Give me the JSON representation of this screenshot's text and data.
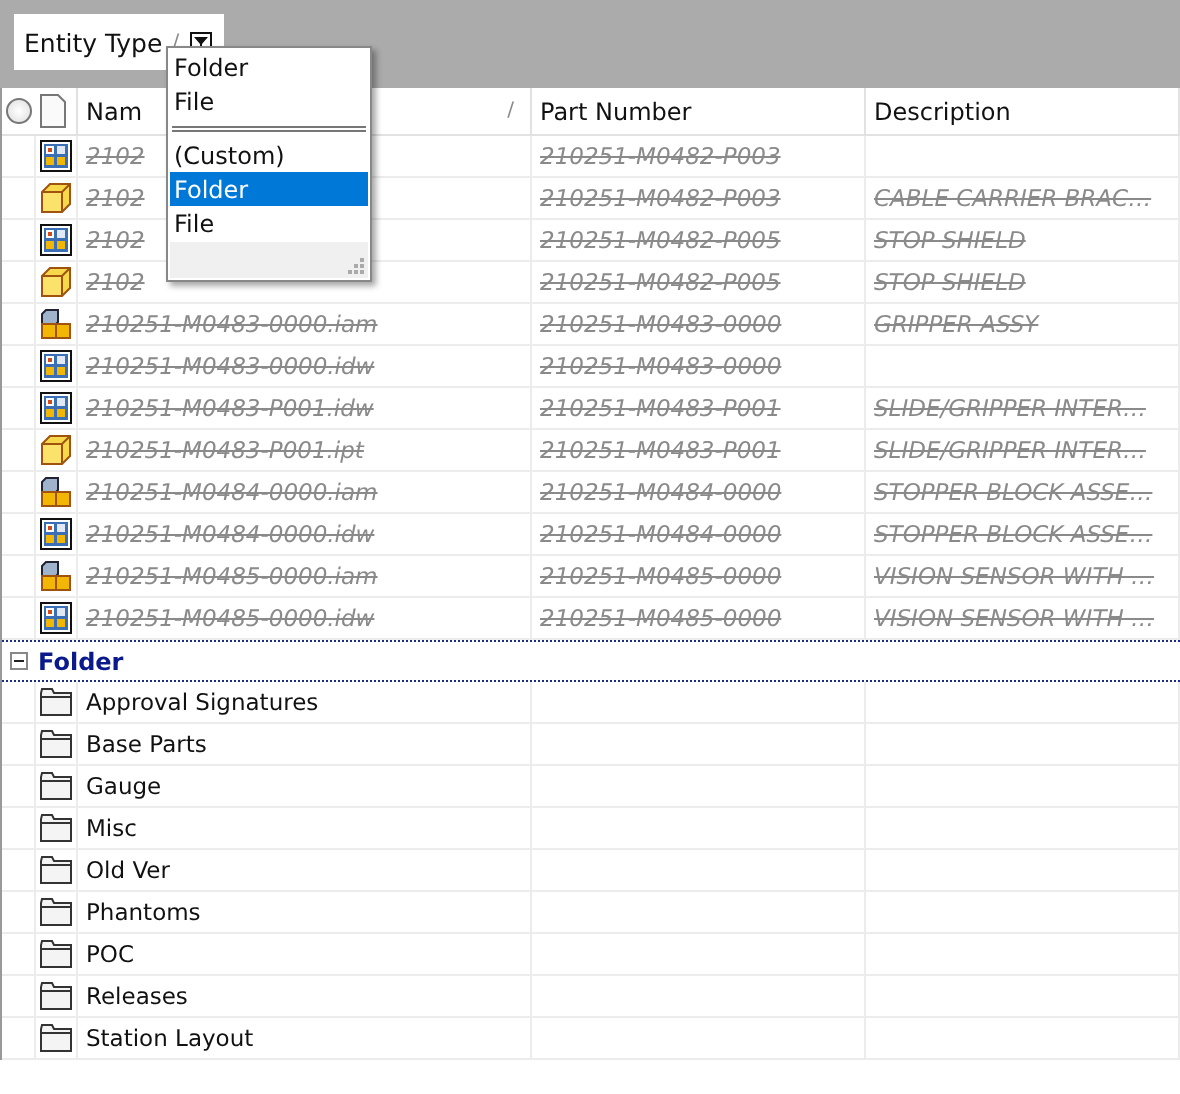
{
  "group_by": {
    "label": "Entity Type",
    "sort_glyph": "/"
  },
  "select_all": {
    "checked": false
  },
  "filter_menu": {
    "items": [
      {
        "kind": "item",
        "label": "Folder",
        "selected": false
      },
      {
        "kind": "item",
        "label": "File",
        "selected": false
      },
      {
        "kind": "separator"
      },
      {
        "kind": "item",
        "label": "(Custom)",
        "selected": false
      },
      {
        "kind": "item",
        "label": "Folder",
        "selected": true
      },
      {
        "kind": "item",
        "label": "File",
        "selected": false
      }
    ]
  },
  "table": {
    "columns": [
      {
        "label": "Nam",
        "sort_glyph": "/"
      },
      {
        "label": "Part Number"
      },
      {
        "label": "Description"
      }
    ],
    "rows": [
      {
        "kind": "drawing",
        "name": "2102",
        "part_number": "210251-M0482-P003",
        "description": "",
        "struck": true
      },
      {
        "kind": "part",
        "name": "2102",
        "part_number": "210251-M0482-P003",
        "description": "CABLE CARRIER BRAC…",
        "struck": true
      },
      {
        "kind": "drawing",
        "name": "2102",
        "part_number": "210251-M0482-P005",
        "description": "STOP SHIELD",
        "struck": true
      },
      {
        "kind": "part",
        "name": "2102",
        "part_number": "210251-M0482-P005",
        "description": "STOP SHIELD",
        "struck": true
      },
      {
        "kind": "assembly",
        "name": "210251-M0483-0000.iam",
        "part_number": "210251-M0483-0000",
        "description": "GRIPPER ASSY",
        "struck": true
      },
      {
        "kind": "drawing",
        "name": "210251-M0483-0000.idw",
        "part_number": "210251-M0483-0000",
        "description": "",
        "struck": true
      },
      {
        "kind": "drawing",
        "name": "210251-M0483-P001.idw",
        "part_number": "210251-M0483-P001",
        "description": "SLIDE/GRIPPER INTER…",
        "struck": true
      },
      {
        "kind": "part",
        "name": "210251-M0483-P001.ipt",
        "part_number": "210251-M0483-P001",
        "description": "SLIDE/GRIPPER INTER…",
        "struck": true
      },
      {
        "kind": "assembly",
        "name": "210251-M0484-0000.iam",
        "part_number": "210251-M0484-0000",
        "description": "STOPPER BLOCK ASSE…",
        "struck": true
      },
      {
        "kind": "drawing",
        "name": "210251-M0484-0000.idw",
        "part_number": "210251-M0484-0000",
        "description": "STOPPER BLOCK ASSE…",
        "struck": true
      },
      {
        "kind": "assembly",
        "name": "210251-M0485-0000.iam",
        "part_number": "210251-M0485-0000",
        "description": "VISION SENSOR WITH …",
        "struck": true
      },
      {
        "kind": "drawing",
        "name": "210251-M0485-0000.idw",
        "part_number": "210251-M0485-0000",
        "description": "VISION SENSOR WITH …",
        "struck": true
      }
    ],
    "group": {
      "label": "Folder",
      "expanded": true,
      "rows": [
        {
          "kind": "folder",
          "name": "Approval Signatures"
        },
        {
          "kind": "folder",
          "name": "Base Parts"
        },
        {
          "kind": "folder",
          "name": "Gauge"
        },
        {
          "kind": "folder",
          "name": "Misc"
        },
        {
          "kind": "folder",
          "name": "Old Ver"
        },
        {
          "kind": "folder",
          "name": "Phantoms"
        },
        {
          "kind": "folder",
          "name": "POC"
        },
        {
          "kind": "folder",
          "name": "Releases"
        },
        {
          "kind": "folder",
          "name": "Station Layout"
        }
      ]
    }
  }
}
